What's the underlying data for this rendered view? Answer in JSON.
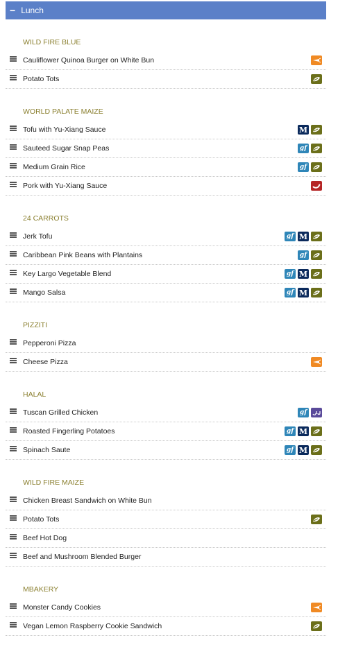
{
  "meal": {
    "toggle": "−",
    "title": "Lunch"
  },
  "stations": [
    {
      "name": "WILD FIRE BLUE",
      "items": [
        {
          "name": "Cauliflower Quinoa Burger on White Bun",
          "badges": [
            "vegan"
          ]
        },
        {
          "name": "Potato Tots",
          "badges": [
            "vegetarian"
          ]
        }
      ]
    },
    {
      "name": "WORLD PALATE MAIZE",
      "items": [
        {
          "name": "Tofu with Yu-Xiang Sauce",
          "badges": [
            "mhealthy",
            "vegetarian"
          ]
        },
        {
          "name": "Sauteed Sugar Snap Peas",
          "badges": [
            "gluten-free",
            "vegetarian"
          ]
        },
        {
          "name": "Medium Grain Rice",
          "badges": [
            "gluten-free",
            "vegetarian"
          ]
        },
        {
          "name": "Pork with Yu-Xiang Sauce",
          "badges": [
            "spicy"
          ]
        }
      ]
    },
    {
      "name": "24 CARROTS",
      "items": [
        {
          "name": "Jerk Tofu",
          "badges": [
            "gluten-free",
            "mhealthy",
            "vegetarian"
          ]
        },
        {
          "name": "Caribbean Pink Beans with Plantains",
          "badges": [
            "gluten-free",
            "vegetarian"
          ]
        },
        {
          "name": "Key Largo Vegetable Blend",
          "badges": [
            "gluten-free",
            "mhealthy",
            "vegetarian"
          ]
        },
        {
          "name": "Mango Salsa",
          "badges": [
            "gluten-free",
            "mhealthy",
            "vegetarian"
          ]
        }
      ]
    },
    {
      "name": "PIZZITI",
      "items": [
        {
          "name": "Pepperoni Pizza",
          "badges": []
        },
        {
          "name": "Cheese Pizza",
          "badges": [
            "vegan"
          ]
        }
      ]
    },
    {
      "name": "HALAL",
      "items": [
        {
          "name": "Tuscan Grilled Chicken",
          "badges": [
            "gluten-free",
            "halal"
          ]
        },
        {
          "name": "Roasted Fingerling Potatoes",
          "badges": [
            "gluten-free",
            "mhealthy",
            "vegetarian"
          ]
        },
        {
          "name": "Spinach Saute",
          "badges": [
            "gluten-free",
            "mhealthy",
            "vegetarian"
          ]
        }
      ]
    },
    {
      "name": "WILD FIRE MAIZE",
      "items": [
        {
          "name": "Chicken Breast Sandwich on White Bun",
          "badges": []
        },
        {
          "name": "Potato Tots",
          "badges": [
            "vegetarian"
          ]
        },
        {
          "name": "Beef Hot Dog",
          "badges": []
        },
        {
          "name": "Beef and Mushroom Blended Burger",
          "badges": []
        }
      ]
    },
    {
      "name": "MBAKERY",
      "items": [
        {
          "name": "Monster Candy Cookies",
          "badges": [
            "vegan"
          ]
        },
        {
          "name": "Vegan Lemon Raspberry Cookie Sandwich",
          "badges": [
            "vegetarian"
          ]
        }
      ]
    }
  ],
  "badge_labels": {
    "gluten-free": "gf",
    "mhealthy": "M"
  },
  "colors": {
    "header": "#5b80c8",
    "station_title": "#8a7f2f",
    "gluten-free": "#2f86b8",
    "mhealthy": "#0b2a5c",
    "vegetarian": "#6b6f1a",
    "vegan": "#f08a24",
    "spicy": "#b52525",
    "halal": "#5a4a9a"
  }
}
